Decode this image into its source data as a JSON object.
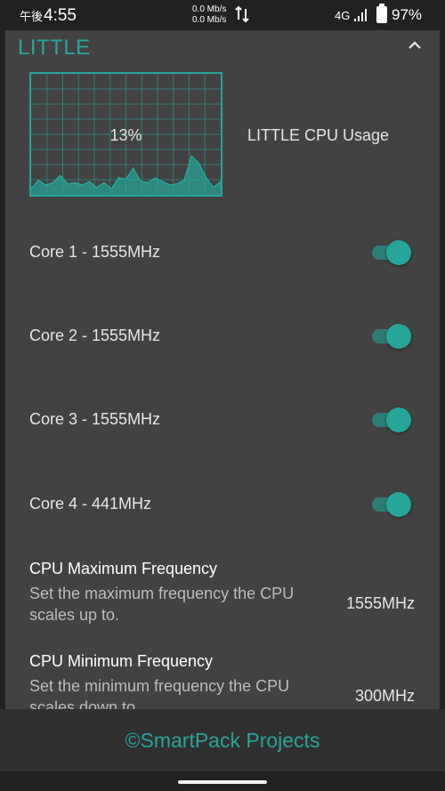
{
  "status_bar": {
    "ampm": "午後",
    "time": "4:55",
    "upload_speed": "0.0 Mb/s",
    "download_speed": "0.0 Mb/s",
    "network": "4G",
    "battery": "97%",
    "icons": [
      "data-transfer-icon",
      "signal-icon",
      "battery-icon"
    ]
  },
  "card": {
    "title": "LITTLE",
    "collapse_icon": "chevron-up-icon",
    "usage_percent": "13%",
    "usage_label": "LITTLE CPU Usage",
    "usage_history_percent": [
      5,
      12,
      8,
      10,
      16,
      9,
      10,
      8,
      11,
      6,
      10,
      5,
      14,
      13,
      22,
      11,
      10,
      14,
      11,
      8,
      9,
      12,
      32,
      26,
      14,
      6,
      11
    ],
    "cores": [
      {
        "label": "Core 1 - 1555MHz",
        "enabled": true
      },
      {
        "label": "Core 2 - 1555MHz",
        "enabled": true
      },
      {
        "label": "Core 3 - 1555MHz",
        "enabled": true
      },
      {
        "label": "Core 4 - 441MHz",
        "enabled": true
      }
    ],
    "max_freq": {
      "title": "CPU Maximum Frequency",
      "description": "Set the maximum frequency the CPU scales up to.",
      "value": "1555MHz"
    },
    "min_freq": {
      "title": "CPU Minimum Frequency",
      "description": "Set the minimum frequency the CPU scales down to.",
      "value": "300MHz"
    }
  },
  "footer": {
    "text": "©SmartPack Projects"
  },
  "colors": {
    "accent": "#26a69a",
    "card": "#424242",
    "background": "#212121",
    "footer": "#303030"
  }
}
